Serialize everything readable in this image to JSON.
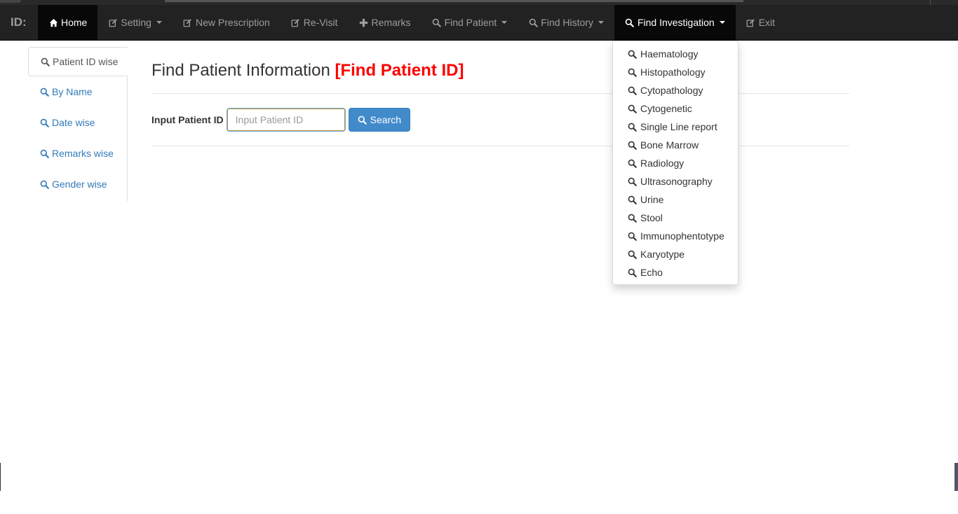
{
  "navbar": {
    "brand": "ID:",
    "items": [
      {
        "label": "Home",
        "icon": "home-icon"
      },
      {
        "label": "Setting",
        "icon": "edit-icon"
      },
      {
        "label": "New Prescription",
        "icon": "edit-icon"
      },
      {
        "label": "Re-Visit",
        "icon": "edit-icon"
      },
      {
        "label": "Remarks",
        "icon": "plus-icon"
      },
      {
        "label": "Find Patient",
        "icon": "search-icon"
      },
      {
        "label": "Find History",
        "icon": "search-icon"
      },
      {
        "label": "Find Investigation",
        "icon": "search-icon"
      },
      {
        "label": "Exit",
        "icon": "edit-icon"
      }
    ]
  },
  "sidebar": {
    "items": [
      {
        "label": "Patient ID wise"
      },
      {
        "label": "By Name"
      },
      {
        "label": "Date wise"
      },
      {
        "label": "Remarks wise"
      },
      {
        "label": "Gender wise"
      }
    ]
  },
  "main": {
    "title": "Find Patient Information",
    "title_highlight": "[Find Patient ID]",
    "form_label": "Input Patient ID",
    "input_placeholder": "Input Patient ID",
    "input_value": "",
    "search_label": "Search"
  },
  "dropdown": {
    "items": [
      {
        "label": "Haematology"
      },
      {
        "label": "Histopathology"
      },
      {
        "label": "Cytopathology"
      },
      {
        "label": "Cytogenetic"
      },
      {
        "label": "Single Line report"
      },
      {
        "label": "Bone Marrow"
      },
      {
        "label": "Radiology"
      },
      {
        "label": "Ultrasonography"
      },
      {
        "label": "Urine"
      },
      {
        "label": "Stool"
      },
      {
        "label": "Immunophentotype"
      },
      {
        "label": "Karyotype"
      },
      {
        "label": "Echo"
      }
    ]
  },
  "colors": {
    "navbar_bg": "#222222",
    "navbar_active_bg": "#080808",
    "link": "#337ab7",
    "highlight_red": "#ff0000",
    "button_primary": "#428bca"
  }
}
